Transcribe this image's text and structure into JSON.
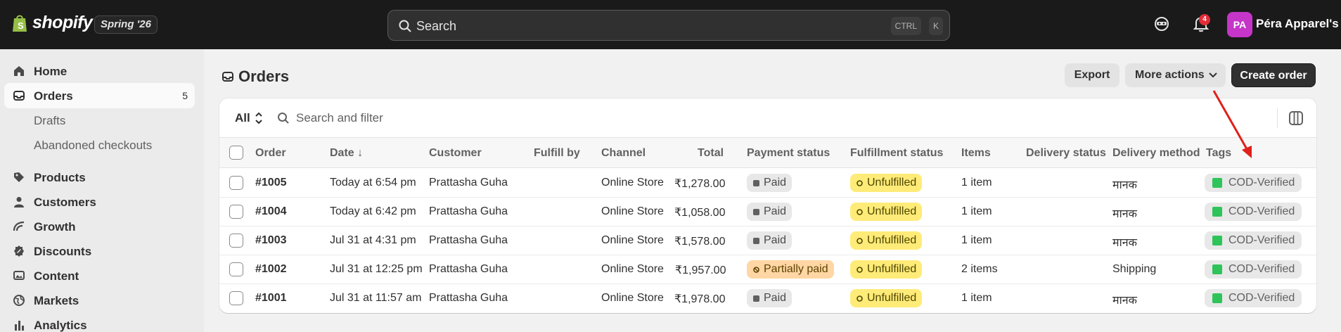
{
  "topbar": {
    "brand": "shopify",
    "edition": "Spring '26",
    "search_placeholder": "Search",
    "shortcut_ctrl": "CTRL",
    "shortcut_k": "K",
    "notification_count": "4",
    "avatar_initials": "PA",
    "store_name": "Péra Apparel's"
  },
  "sidebar": {
    "items": [
      {
        "label": "Home",
        "icon": "home-icon"
      },
      {
        "label": "Orders",
        "icon": "orders-icon",
        "count": "5",
        "active": true
      },
      {
        "label": "Drafts",
        "sub": true
      },
      {
        "label": "Abandoned checkouts",
        "sub": true
      },
      {
        "label": "Products",
        "icon": "tag-icon"
      },
      {
        "label": "Customers",
        "icon": "person-icon"
      },
      {
        "label": "Growth",
        "icon": "growth-icon"
      },
      {
        "label": "Discounts",
        "icon": "discount-icon"
      },
      {
        "label": "Content",
        "icon": "content-icon"
      },
      {
        "label": "Markets",
        "icon": "globe-icon"
      },
      {
        "label": "Analytics",
        "icon": "analytics-icon"
      }
    ]
  },
  "page": {
    "title": "Orders",
    "export_label": "Export",
    "more_actions_label": "More actions",
    "create_order_label": "Create order"
  },
  "filter": {
    "view": "All",
    "search_placeholder": "Search and filter"
  },
  "table": {
    "headers": {
      "order": "Order",
      "date": "Date ↓",
      "customer": "Customer",
      "fulfill_by": "Fulfill by",
      "channel": "Channel",
      "total": "Total",
      "payment_status": "Payment status",
      "fulfillment_status": "Fulfillment status",
      "items": "Items",
      "delivery_status": "Delivery status",
      "delivery_method": "Delivery method",
      "tags": "Tags"
    },
    "rows": [
      {
        "order": "#1005",
        "date": "Today at 6:54 pm",
        "customer": "Prattasha Guha",
        "channel": "Online Store",
        "total": "₹1,278.00",
        "payment": "Paid",
        "fulfillment": "Unfulfilled",
        "items": "1 item",
        "delivery_method": "मानक",
        "tag": "COD-Verified"
      },
      {
        "order": "#1004",
        "date": "Today at 6:42 pm",
        "customer": "Prattasha Guha",
        "channel": "Online Store",
        "total": "₹1,058.00",
        "payment": "Paid",
        "fulfillment": "Unfulfilled",
        "items": "1 item",
        "delivery_method": "मानक",
        "tag": "COD-Verified"
      },
      {
        "order": "#1003",
        "date": "Jul 31 at 4:31 pm",
        "customer": "Prattasha Guha",
        "channel": "Online Store",
        "total": "₹1,578.00",
        "payment": "Paid",
        "fulfillment": "Unfulfilled",
        "items": "1 item",
        "delivery_method": "मानक",
        "tag": "COD-Verified"
      },
      {
        "order": "#1002",
        "date": "Jul 31 at 12:25 pm",
        "customer": "Prattasha Guha",
        "channel": "Online Store",
        "total": "₹1,957.00",
        "payment": "Partially paid",
        "fulfillment": "Unfulfilled",
        "items": "2 items",
        "delivery_method": "Shipping",
        "tag": "COD-Verified"
      },
      {
        "order": "#1001",
        "date": "Jul 31 at 11:57 am",
        "customer": "Prattasha Guha",
        "channel": "Online Store",
        "total": "₹1,978.00",
        "payment": "Paid",
        "fulfillment": "Unfulfilled",
        "items": "1 item",
        "delivery_method": "मानक",
        "tag": "COD-Verified"
      }
    ]
  },
  "colors": {
    "topbar_bg": "#1a1a1a",
    "annotation_arrow": "#e0201c",
    "partially_paid_badge": "#ffd6a4",
    "unfulfilled_badge": "#ffeb78",
    "tag_check": "#2ec45a"
  }
}
